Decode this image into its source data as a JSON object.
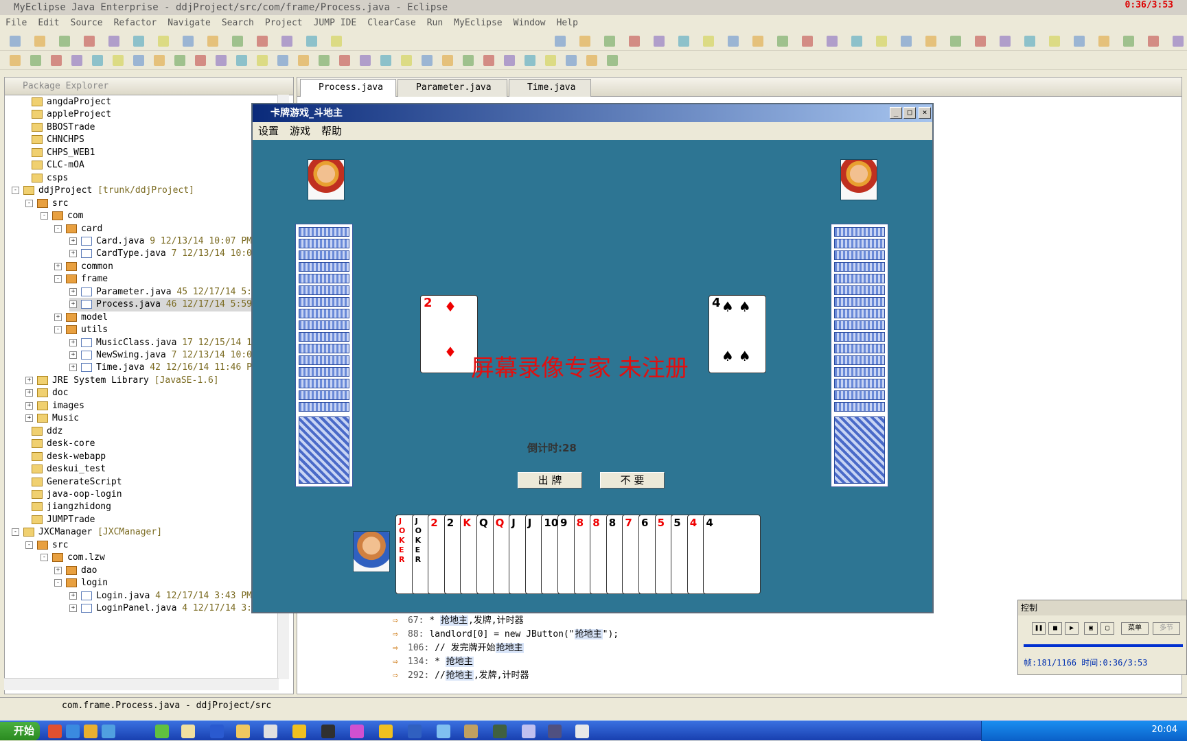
{
  "window": {
    "title": "MyEclipse Java Enterprise - ddjProject/src/com/frame/Process.java - Eclipse",
    "recording": "0:36/3:53"
  },
  "menu": [
    "File",
    "Edit",
    "Source",
    "Refactor",
    "Navigate",
    "Search",
    "Project",
    "JUMP IDE",
    "ClearCase",
    "Run",
    "MyEclipse",
    "Window",
    "Help"
  ],
  "package_explorer": {
    "title": "Package Explorer",
    "rows": [
      {
        "label": "angdaProject",
        "meta": ""
      },
      {
        "label": "appleProject",
        "meta": ""
      },
      {
        "label": "BBOSTrade",
        "meta": ""
      },
      {
        "label": "CHNCHPS",
        "meta": ""
      },
      {
        "label": "CHPS_WEB1",
        "meta": ""
      },
      {
        "label": "CLC-mOA",
        "meta": ""
      },
      {
        "label": "csps",
        "meta": ""
      },
      {
        "label": "ddjProject",
        "meta": "[trunk/ddjProject]"
      },
      {
        "label": "src",
        "meta": ""
      },
      {
        "label": "com",
        "meta": ""
      },
      {
        "label": "card",
        "meta": ""
      },
      {
        "label": "Card.java",
        "meta": "9  12/13/14 10:07 PM"
      },
      {
        "label": "CardType.java",
        "meta": "7  12/13/14 10:0"
      },
      {
        "label": "common",
        "meta": ""
      },
      {
        "label": "frame",
        "meta": ""
      },
      {
        "label": "Parameter.java",
        "meta": "45  12/17/14 5:"
      },
      {
        "label": "Process.java",
        "meta": "46  12/17/14 5:59"
      },
      {
        "label": "model",
        "meta": ""
      },
      {
        "label": "utils",
        "meta": ""
      },
      {
        "label": "MusicClass.java",
        "meta": "17  12/15/14 1"
      },
      {
        "label": "NewSwing.java",
        "meta": "7  12/13/14 10:0"
      },
      {
        "label": "Time.java",
        "meta": "42  12/16/14 11:46 P"
      },
      {
        "label": "JRE System Library",
        "meta": "[JavaSE-1.6]"
      },
      {
        "label": "doc",
        "meta": ""
      },
      {
        "label": "images",
        "meta": ""
      },
      {
        "label": "Music",
        "meta": ""
      },
      {
        "label": "ddz",
        "meta": ""
      },
      {
        "label": "desk-core",
        "meta": ""
      },
      {
        "label": "desk-webapp",
        "meta": ""
      },
      {
        "label": "deskui_test",
        "meta": ""
      },
      {
        "label": "GenerateScript",
        "meta": ""
      },
      {
        "label": "java-oop-login",
        "meta": ""
      },
      {
        "label": "jiangzhidong",
        "meta": ""
      },
      {
        "label": "JUMPTrade",
        "meta": ""
      },
      {
        "label": "JXCManager",
        "meta": "[JXCManager]"
      },
      {
        "label": "src",
        "meta": ""
      },
      {
        "label": "com.lzw",
        "meta": ""
      },
      {
        "label": "dao",
        "meta": ""
      },
      {
        "label": "login",
        "meta": ""
      },
      {
        "label": "Login.java",
        "meta": "4  12/17/14 3:43 PM  admi"
      },
      {
        "label": "LoginPanel.java",
        "meta": "4  12/17/14 3:43 PM"
      }
    ]
  },
  "editor_tabs": [
    "Process.java",
    "Parameter.java",
    "Time.java"
  ],
  "search_results": [
    {
      "line": "67: ",
      "pre": "* ",
      "hl": "抢地主",
      "post": ",发牌,计时器"
    },
    {
      "line": "88: ",
      "pre": "landlord[0] = new JButton(\"",
      "hl": "抢地主",
      "post": "\");"
    },
    {
      "line": "106: ",
      "pre": "// 发完牌开始",
      "hl": "抢地主",
      "post": ""
    },
    {
      "line": "134: ",
      "pre": "* ",
      "hl": "抢地主",
      "post": ""
    },
    {
      "line": "292: ",
      "pre": "//",
      "hl": "抢地主",
      "post": ",发牌,计时器"
    }
  ],
  "game": {
    "title": "卡牌游戏_斗地主",
    "menu": [
      "设置",
      "游戏",
      "帮助"
    ],
    "watermark": "屏幕录像专家  未注册",
    "countdown": "倒计时:28",
    "play_button": "出 牌",
    "pass_button": "不 要",
    "played_left": "2",
    "played_right": "4",
    "hand": [
      "JOKER",
      "JOKER",
      "2",
      "2",
      "K",
      "Q",
      "Q",
      "J",
      "J",
      "10",
      "9",
      "8",
      "8",
      "8",
      "7",
      "6",
      "5",
      "5",
      "4",
      "4"
    ]
  },
  "recorder": {
    "title": "控制",
    "menu_label": "菜单",
    "extra_label": "多节",
    "info": "帧:181/1166 时间:0:36/3:53"
  },
  "status": "com.frame.Process.java - ddjProject/src",
  "taskbar": {
    "start": "开始",
    "clock": "20:04"
  }
}
